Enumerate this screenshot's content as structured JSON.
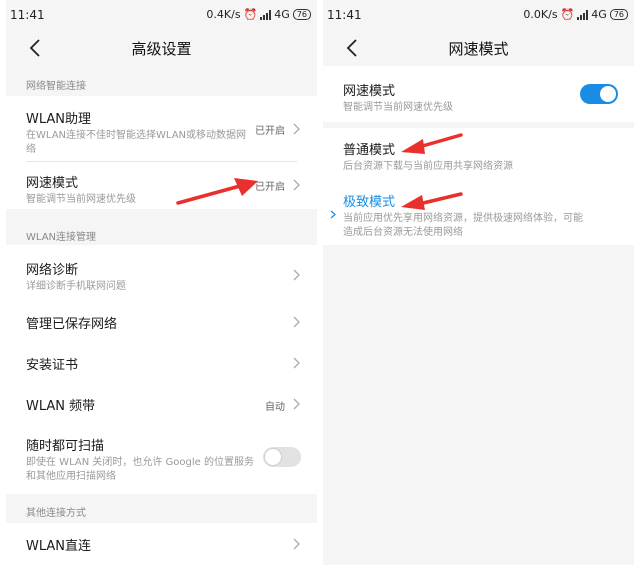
{
  "colors": {
    "accent": "#1b8ce3",
    "arrow": "#e8302c"
  },
  "left": {
    "status": {
      "time": "11:41",
      "speed": "0.4K/s",
      "net": "4G",
      "battery": "76"
    },
    "nav": {
      "title": "高级设置"
    },
    "sections": [
      {
        "header": "网络智能连接"
      },
      {
        "header": "WLAN连接管理"
      },
      {
        "header": "其他连接方式"
      }
    ],
    "items": {
      "wlan_assist": {
        "title": "WLAN助理",
        "subtitle": "在WLAN连接不佳时智能选择WLAN或移动数据网络",
        "value": "已开启"
      },
      "speed_mode": {
        "title": "网速模式",
        "subtitle": "智能调节当前网速优先级",
        "value": "已开启"
      },
      "diagnose": {
        "title": "网络诊断",
        "subtitle": "详细诊断手机联网问题"
      },
      "saved": {
        "title": "管理已保存网络"
      },
      "cert": {
        "title": "安装证书"
      },
      "band": {
        "title": "WLAN 频带",
        "value": "自动"
      },
      "scan": {
        "title": "随时都可扫描",
        "subtitle": "即使在 WLAN 关闭时，也允许 Google 的位置服务和其他应用扫描网络",
        "toggle_on": false
      },
      "direct": {
        "title": "WLAN直连"
      }
    }
  },
  "right": {
    "status": {
      "time": "11:41",
      "speed": "0.0K/s",
      "net": "4G",
      "battery": "76"
    },
    "nav": {
      "title": "网速模式"
    },
    "items": {
      "master": {
        "title": "网速模式",
        "subtitle": "智能调节当前网速优先级",
        "toggle_on": true
      },
      "normal": {
        "title": "普通模式",
        "subtitle": "后台资源下载与当前应用共享网络资源"
      },
      "extreme": {
        "title": "极致模式",
        "subtitle": "当前应用优先享用网络资源，提供极速网络体验，可能造成后台资源无法使用网络",
        "selected": true
      }
    }
  }
}
